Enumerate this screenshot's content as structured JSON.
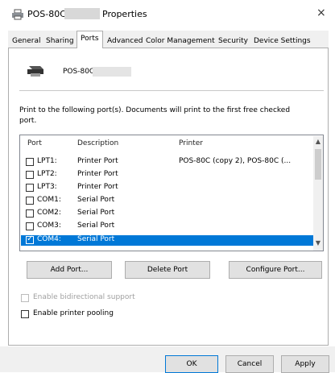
{
  "window": {
    "title_prefix": "POS-80C",
    "title_suffix": "Properties",
    "close_glyph": "×"
  },
  "tabs": [
    {
      "label": "General",
      "active": false
    },
    {
      "label": "Sharing",
      "active": false
    },
    {
      "label": "Ports",
      "active": true
    },
    {
      "label": "Advanced",
      "active": false
    },
    {
      "label": "Color Management",
      "active": false
    },
    {
      "label": "Security",
      "active": false
    },
    {
      "label": "Device Settings",
      "active": false
    }
  ],
  "printer": {
    "name": "POS-80C",
    "icon": "printer-icon"
  },
  "instructions": "Print to the following port(s). Documents will print to the first free checked port.",
  "port_list": {
    "headers": {
      "port": "Port",
      "description": "Description",
      "printer": "Printer"
    },
    "rows": [
      {
        "port": "LPT1:",
        "description": "Printer Port",
        "printer": "POS-80C (copy 2), POS-80C (...",
        "checked": false,
        "selected": false
      },
      {
        "port": "LPT2:",
        "description": "Printer Port",
        "printer": "",
        "checked": false,
        "selected": false
      },
      {
        "port": "LPT3:",
        "description": "Printer Port",
        "printer": "",
        "checked": false,
        "selected": false
      },
      {
        "port": "COM1:",
        "description": "Serial Port",
        "printer": "",
        "checked": false,
        "selected": false
      },
      {
        "port": "COM2:",
        "description": "Serial Port",
        "printer": "",
        "checked": false,
        "selected": false
      },
      {
        "port": "COM3:",
        "description": "Serial Port",
        "printer": "",
        "checked": false,
        "selected": false
      },
      {
        "port": "COM4:",
        "description": "Serial Port",
        "printer": "",
        "checked": true,
        "selected": true
      }
    ]
  },
  "port_buttons": {
    "add": "Add Port...",
    "delete": "Delete Port",
    "configure": "Configure Port..."
  },
  "options": {
    "bidirectional": {
      "label": "Enable bidirectional support",
      "checked": false,
      "enabled": false
    },
    "pooling": {
      "label": "Enable printer pooling",
      "checked": false,
      "enabled": true
    }
  },
  "footer": {
    "ok": "OK",
    "cancel": "Cancel",
    "apply": "Apply"
  },
  "colors": {
    "selection": "#0078d7",
    "button_face": "#e1e1e1",
    "dialog_bg": "#f0f0f0"
  }
}
